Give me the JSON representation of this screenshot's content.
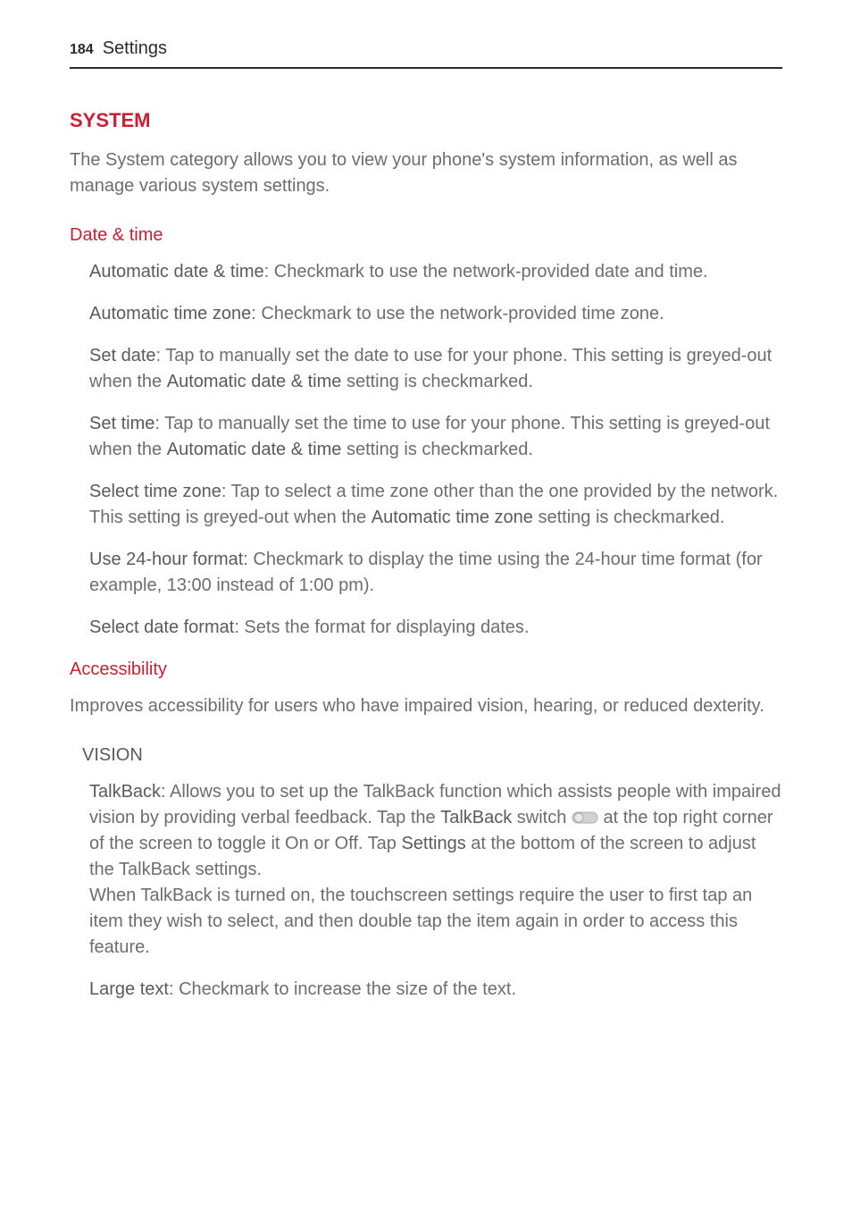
{
  "header": {
    "page_number": "184",
    "title": "Settings"
  },
  "section": {
    "heading": "SYSTEM",
    "intro": "The System category allows you to view your phone's system information, as well as manage various system settings."
  },
  "date_time": {
    "heading": "Date & time",
    "auto_date": {
      "term": "Automatic date & time",
      "text": ": Checkmark to use the network-provided date and time."
    },
    "auto_tz": {
      "term": "Automatic time zone",
      "text": ": Checkmark to use the network-provided time zone."
    },
    "set_date": {
      "term": "Set date",
      "text_a": ": Tap to manually set the date to use for your phone. This setting is greyed-out when the ",
      "bold": "Automatic date & time",
      "text_b": " setting is checkmarked."
    },
    "set_time": {
      "term": "Set time",
      "text_a": ": Tap to manually set the time to use for your phone. This setting is greyed-out when the ",
      "bold": "Automatic date & time",
      "text_b": " setting is checkmarked."
    },
    "select_tz": {
      "term": "Select time zone",
      "text_a": ": Tap to select a time zone other than the one provided by the network. This setting is greyed-out when the ",
      "bold": "Automatic time zone",
      "text_b": " setting is checkmarked."
    },
    "hour24": {
      "term": "Use 24-hour format",
      "text": ": Checkmark to display the time using the 24-hour time format (for example, 13:00 instead of 1:00 pm)."
    },
    "date_format": {
      "term": "Select date format",
      "text": ": Sets the format for displaying dates."
    }
  },
  "accessibility": {
    "heading": "Accessibility",
    "intro": "Improves accessibility for users who have impaired vision, hearing, or reduced dexterity.",
    "vision_label": "VISION",
    "talkback": {
      "term": "TalkBack",
      "text_a": ": Allows you to set up the TalkBack function which assists people with impaired vision by providing verbal feedback. Tap the ",
      "bold_a": "TalkBack",
      "text_b": " switch ",
      "text_c": " at the top right corner of the screen to toggle it On or Off. Tap ",
      "bold_b": "Settings",
      "text_d": " at the bottom of the screen to adjust the TalkBack settings.",
      "para2": "When TalkBack is turned on, the touchscreen settings require the user to first tap an item they wish to select, and then double tap the item again in order to access this feature."
    },
    "large_text": {
      "term": "Large text",
      "text": ": Checkmark to increase the size of the text."
    }
  }
}
